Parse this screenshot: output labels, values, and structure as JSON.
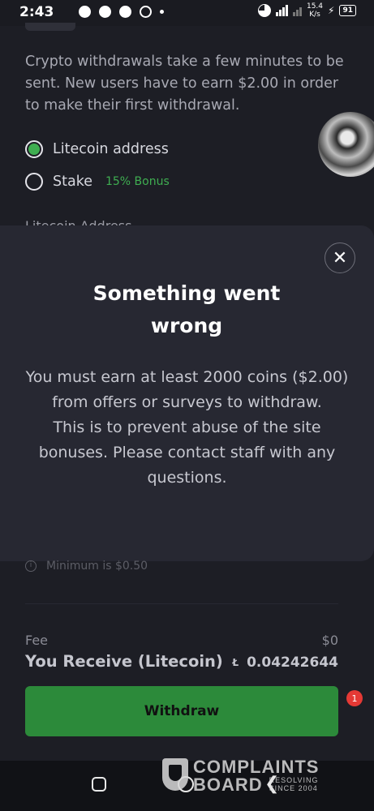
{
  "status_bar": {
    "time": "2:43",
    "network_speed_value": "15.4",
    "network_speed_unit": "K/s",
    "battery": "91"
  },
  "withdraw_page": {
    "intro_text": "Crypto withdrawals take a few minutes to be sent. New users have to earn $2.00 in order to make their first withdrawal.",
    "options": [
      {
        "label": "Litecoin address",
        "selected": true
      },
      {
        "label": "Stake",
        "bonus": "15% Bonus",
        "selected": false
      }
    ],
    "address_label": "Litecoin Address",
    "minimum_hint": "Minimum is $0.50",
    "fee_label": "Fee",
    "fee_value": "$0",
    "receive_label": "You Receive (Litecoin)",
    "receive_value": "0.04242644",
    "withdraw_button": "Withdraw",
    "notification_count": "1"
  },
  "modal": {
    "title": "Something went wrong",
    "message_line1": "You must earn at least 2000 coins ($2.00) from offers or surveys to withdraw.",
    "message_line2": "This is to prevent abuse of the site bonuses. Please contact staff with any questions.",
    "close_symbol": "✕"
  },
  "watermark": {
    "line1": "COMPLAINTS",
    "line2": "BOARD",
    "sub1": "RESOLVING",
    "sub2": "SINCE 2004"
  },
  "colors": {
    "background": "#1d1e25",
    "modal": "#272832",
    "accent_green": "#3fae51",
    "button_green": "#2c8a3a",
    "badge_red": "#e53935"
  }
}
